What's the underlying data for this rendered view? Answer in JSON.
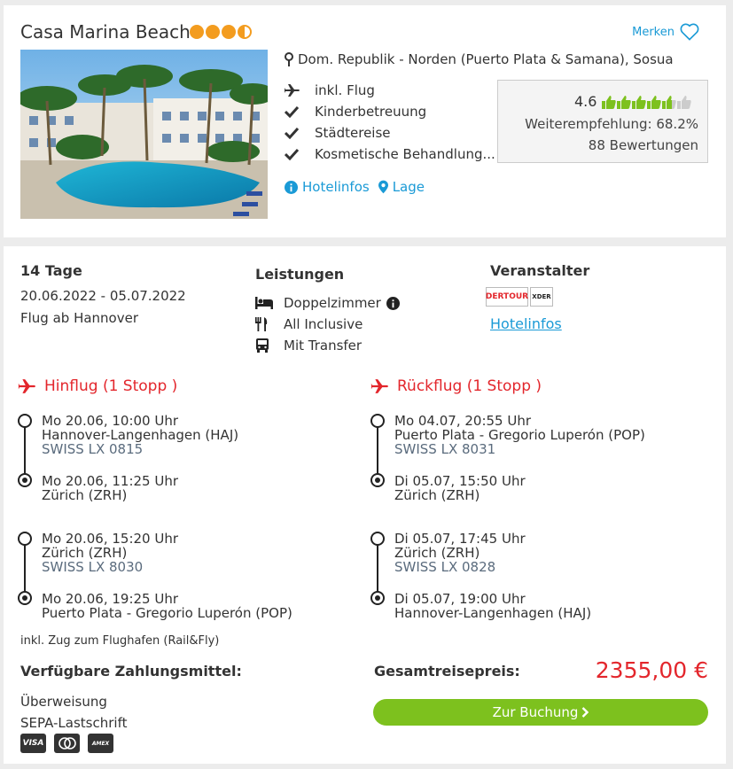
{
  "hotel": {
    "name": "Casa Marina Beach",
    "stars": 3.5,
    "merken_label": "Merken",
    "location": "Dom. Republik - Norden (Puerto Plata & Samana), Sosua",
    "features": [
      {
        "icon": "plane-icon",
        "label": "inkl. Flug"
      },
      {
        "icon": "check-icon",
        "label": "Kinderbetreuung"
      },
      {
        "icon": "check-icon",
        "label": "Städtereise"
      },
      {
        "icon": "check-icon",
        "label": "Kosmetische Behandlung..."
      }
    ],
    "links": {
      "hotelinfos": "Hotelinfos",
      "lage": "Lage"
    },
    "rating": {
      "score": "4.6",
      "thumbs": 4.5,
      "recommendation": "Weiterempfehlung: 68.2%",
      "reviews": "88 Bewertungen"
    }
  },
  "offer": {
    "duration": "14 Tage",
    "dates": "20.06.2022 - 05.07.2022",
    "departure": "Flug ab Hannover",
    "services_title": "Leistungen",
    "services": [
      {
        "icon": "bed-icon",
        "label": "Doppelzimmer"
      },
      {
        "icon": "cutlery-icon",
        "label": "All Inclusive"
      },
      {
        "icon": "bus-icon",
        "label": "Mit Transfer"
      }
    ],
    "operator_title": "Veranstalter",
    "operator_logos": [
      "DERTOUR",
      "XDER"
    ],
    "operator_link": "Hotelinfos",
    "outbound": {
      "title": "Hinflug (1 Stopp )",
      "segments": [
        {
          "dep_time": "Mo 20.06, 10:00 Uhr",
          "dep_airport": "Hannover-Langenhagen (HAJ)",
          "flight": "SWISS LX 0815",
          "arr_time": "Mo 20.06, 11:25 Uhr",
          "arr_airport": "Zürich (ZRH)"
        },
        {
          "dep_time": "Mo 20.06, 15:20 Uhr",
          "dep_airport": "Zürich (ZRH)",
          "flight": "SWISS LX 8030",
          "arr_time": "Mo 20.06, 19:25 Uhr",
          "arr_airport": "Puerto Plata - Gregorio Luperón (POP)"
        }
      ]
    },
    "return": {
      "title": "Rückflug (1 Stopp )",
      "segments": [
        {
          "dep_time": "Mo 04.07, 20:55 Uhr",
          "dep_airport": "Puerto Plata - Gregorio Luperón (POP)",
          "flight": "SWISS LX 8031",
          "arr_time": "Di 05.07, 15:50 Uhr",
          "arr_airport": "Zürich (ZRH)"
        },
        {
          "dep_time": "Di 05.07, 17:45 Uhr",
          "dep_airport": "Zürich (ZRH)",
          "flight": "SWISS LX 0828",
          "arr_time": "Di 05.07, 19:00 Uhr",
          "arr_airport": "Hannover-Langenhagen (HAJ)"
        }
      ]
    },
    "rail_note": "inkl. Zug zum Flughafen (Rail&Fly)",
    "payment_title": "Verfügbare Zahlungsmittel:",
    "payment_methods": [
      "Überweisung",
      "SEPA-Lastschrift"
    ],
    "cards": [
      "VISA",
      "MC",
      "AMEX"
    ],
    "total_label": "Gesamtreisepreis:",
    "total_price": "2355,00 €",
    "book_label": "Zur Buchung"
  },
  "colors": {
    "accent_blue": "#1a9ad6",
    "flight_red": "#e3262c",
    "star_orange": "#f39c1f",
    "button_green": "#7dc11e",
    "thumb_green": "#7dc11e"
  }
}
